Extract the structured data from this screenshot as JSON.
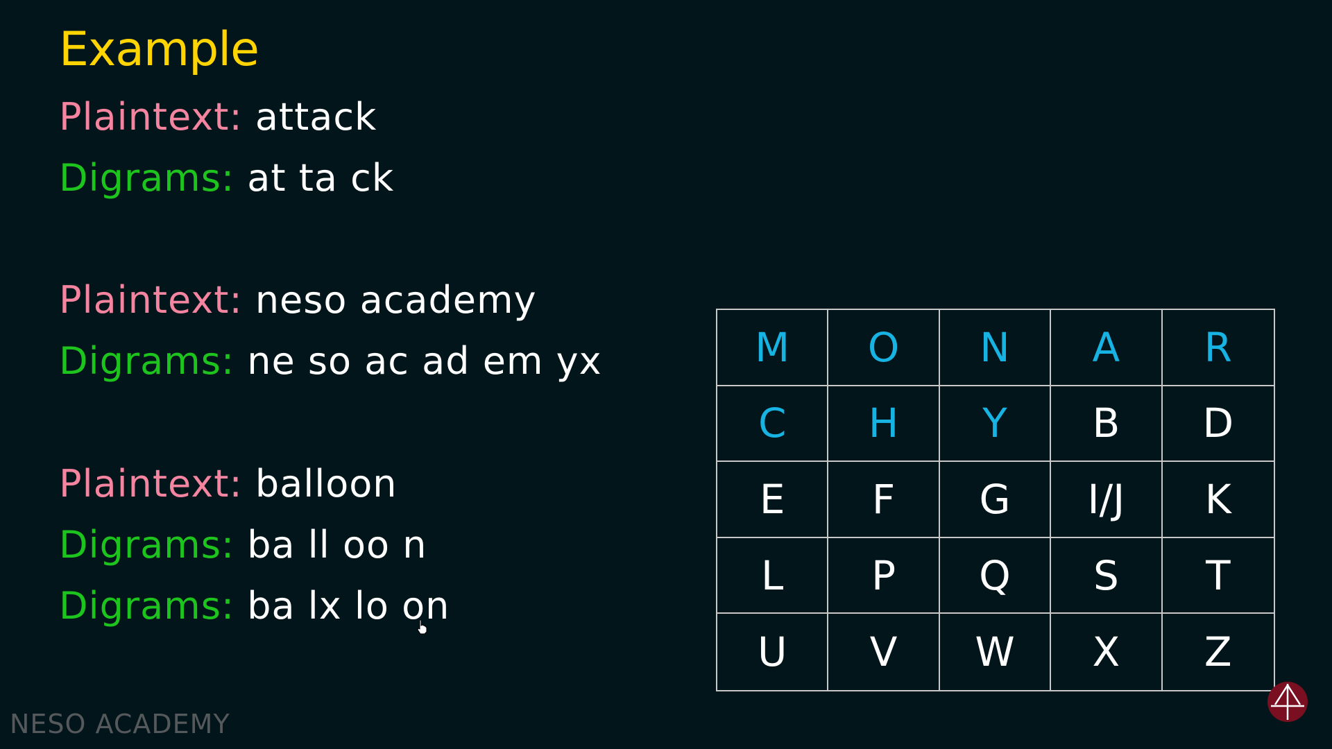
{
  "title": "Example",
  "examples": [
    {
      "plaintext_label": "Plaintext:",
      "plaintext": "attack",
      "digram_lines": [
        {
          "label": "Digrams:",
          "value": "at ta ck"
        }
      ]
    },
    {
      "plaintext_label": "Plaintext:",
      "plaintext": "neso academy",
      "digram_lines": [
        {
          "label": "Digrams:",
          "value": "ne so ac ad em yx"
        }
      ]
    },
    {
      "plaintext_label": "Plaintext:",
      "plaintext": "balloon",
      "digram_lines": [
        {
          "label": "Digrams:",
          "value": "ba ll oo n"
        },
        {
          "label": "Digrams:",
          "value": "ba lx lo on"
        }
      ]
    }
  ],
  "key_matrix": [
    [
      "M",
      "O",
      "N",
      "A",
      "R"
    ],
    [
      "C",
      "H",
      "Y",
      "B",
      "D"
    ],
    [
      "E",
      "F",
      "G",
      "I/J",
      "K"
    ],
    [
      "L",
      "P",
      "Q",
      "S",
      "T"
    ],
    [
      "U",
      "V",
      "W",
      "X",
      "Z"
    ]
  ],
  "key_letters": [
    "M",
    "O",
    "N",
    "A",
    "R",
    "C",
    "H",
    "Y"
  ],
  "watermark": "NESO ACADEMY",
  "colors": {
    "background": "#02151a",
    "title": "#ffd400",
    "plaintext_label": "#f4849f",
    "digram_label": "#1ec41e",
    "key_letter": "#17b3e3",
    "text": "#ffffff",
    "grid_border": "#c8c8c8"
  },
  "icons": {
    "logo": "neso-academy-logo-icon",
    "cursor": "hand-pointer-icon"
  }
}
